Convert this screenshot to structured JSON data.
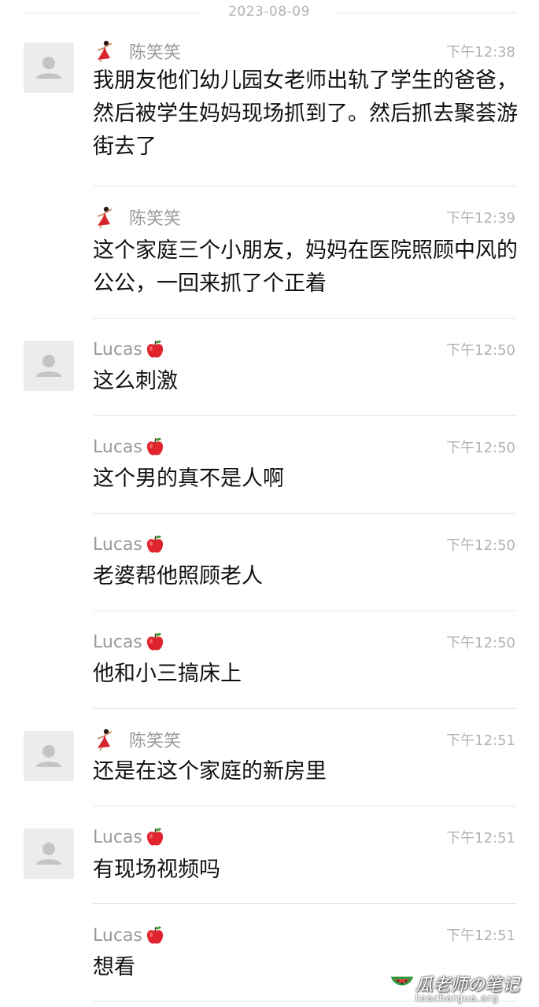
{
  "chat": {
    "date": "2023-08-09",
    "messages": [
      {
        "sender": "陈笑笑",
        "time": "下午12:38",
        "text": "我朋友他们幼儿园女老师出轨了学生的爸爸，然后被学生妈妈现场抓到了。然后抓去聚荟游街去了"
      },
      {
        "sender": "陈笑笑",
        "time": "下午12:39",
        "text": "这个家庭三个小朋友，妈妈在医院照顾中风的公公，一回来抓了个正着"
      },
      {
        "sender": "Lucas",
        "time": "下午12:50",
        "text": "这么刺激"
      },
      {
        "sender": "Lucas",
        "time": "下午12:50",
        "text": "这个男的真不是人啊"
      },
      {
        "sender": "Lucas",
        "time": "下午12:50",
        "text": "老婆帮他照顾老人"
      },
      {
        "sender": "Lucas",
        "time": "下午12:50",
        "text": "他和小三搞床上"
      },
      {
        "sender": "陈笑笑",
        "time": "下午12:51",
        "text": "还是在这个家庭的新房里"
      },
      {
        "sender": "Lucas",
        "time": "下午12:51",
        "text": "有现场视频吗"
      },
      {
        "sender": "Lucas",
        "time": "下午12:51",
        "text": "想看"
      }
    ]
  },
  "watermark": {
    "title": "瓜老师の笔记",
    "url": "teachergua.org"
  },
  "icons": {
    "avatar": "default-avatar-icon",
    "chen_badge": "dancer-emoji-icon",
    "lucas_badge": "red-apple-emoji-icon",
    "watermark_logo": "watermelon-icon"
  },
  "colors": {
    "background": "#ffffff",
    "avatar_bg": "#ececec",
    "sender_text": "#9a9a9a",
    "time_text": "#b2b2b2",
    "message_text": "#111111",
    "divider": "#e5e5e5"
  }
}
